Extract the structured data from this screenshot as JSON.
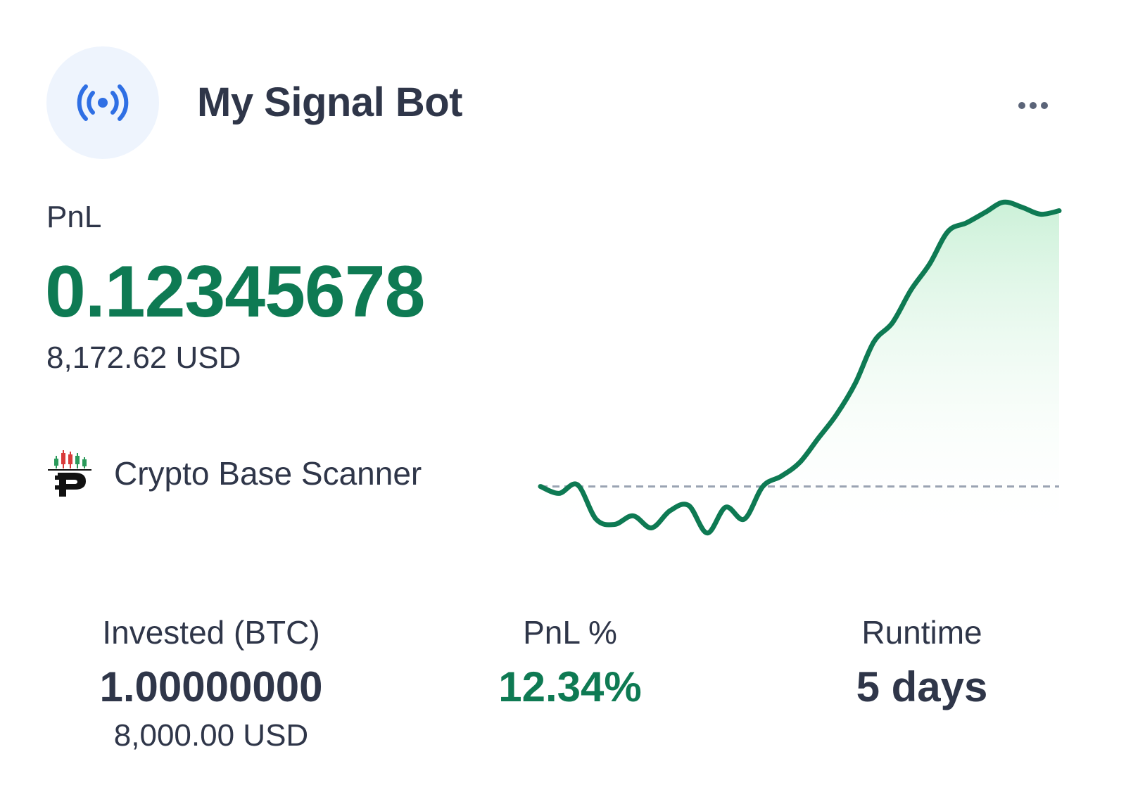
{
  "bot": {
    "name": "My Signal Bot",
    "icon": "signal-broadcast-icon",
    "accent_color": "#2f6fe4",
    "menu_icon": "more-horizontal-icon"
  },
  "pnl": {
    "label": "PnL",
    "value": "0.12345678",
    "usd": "8,172.62 USD",
    "color": "#0e7a53"
  },
  "source": {
    "name": "Crypto Base Scanner",
    "logo": "crypto-base-scanner-logo"
  },
  "stats": {
    "invested": {
      "label": "Invested (BTC)",
      "value": "1.00000000",
      "usd": "8,000.00 USD"
    },
    "pnl_percent": {
      "label": "PnL %",
      "value": "12.34%"
    },
    "runtime": {
      "label": "Runtime",
      "value": "5 days"
    }
  },
  "chart_data": {
    "type": "area",
    "baseline": 0,
    "line_color": "#0e7a53",
    "fill_color": "#d9f5e3",
    "baseline_style": "dashed",
    "values": [
      0,
      -0.4,
      0.1,
      -1.9,
      -2.2,
      -1.7,
      -2.4,
      -1.4,
      -1.1,
      -2.7,
      -1.2,
      -1.9,
      0,
      0.6,
      1.4,
      2.8,
      4.2,
      6.0,
      8.4,
      9.5,
      11.4,
      12.9,
      14.8,
      15.3,
      15.9,
      16.5,
      16.2,
      15.8,
      16.0
    ]
  }
}
